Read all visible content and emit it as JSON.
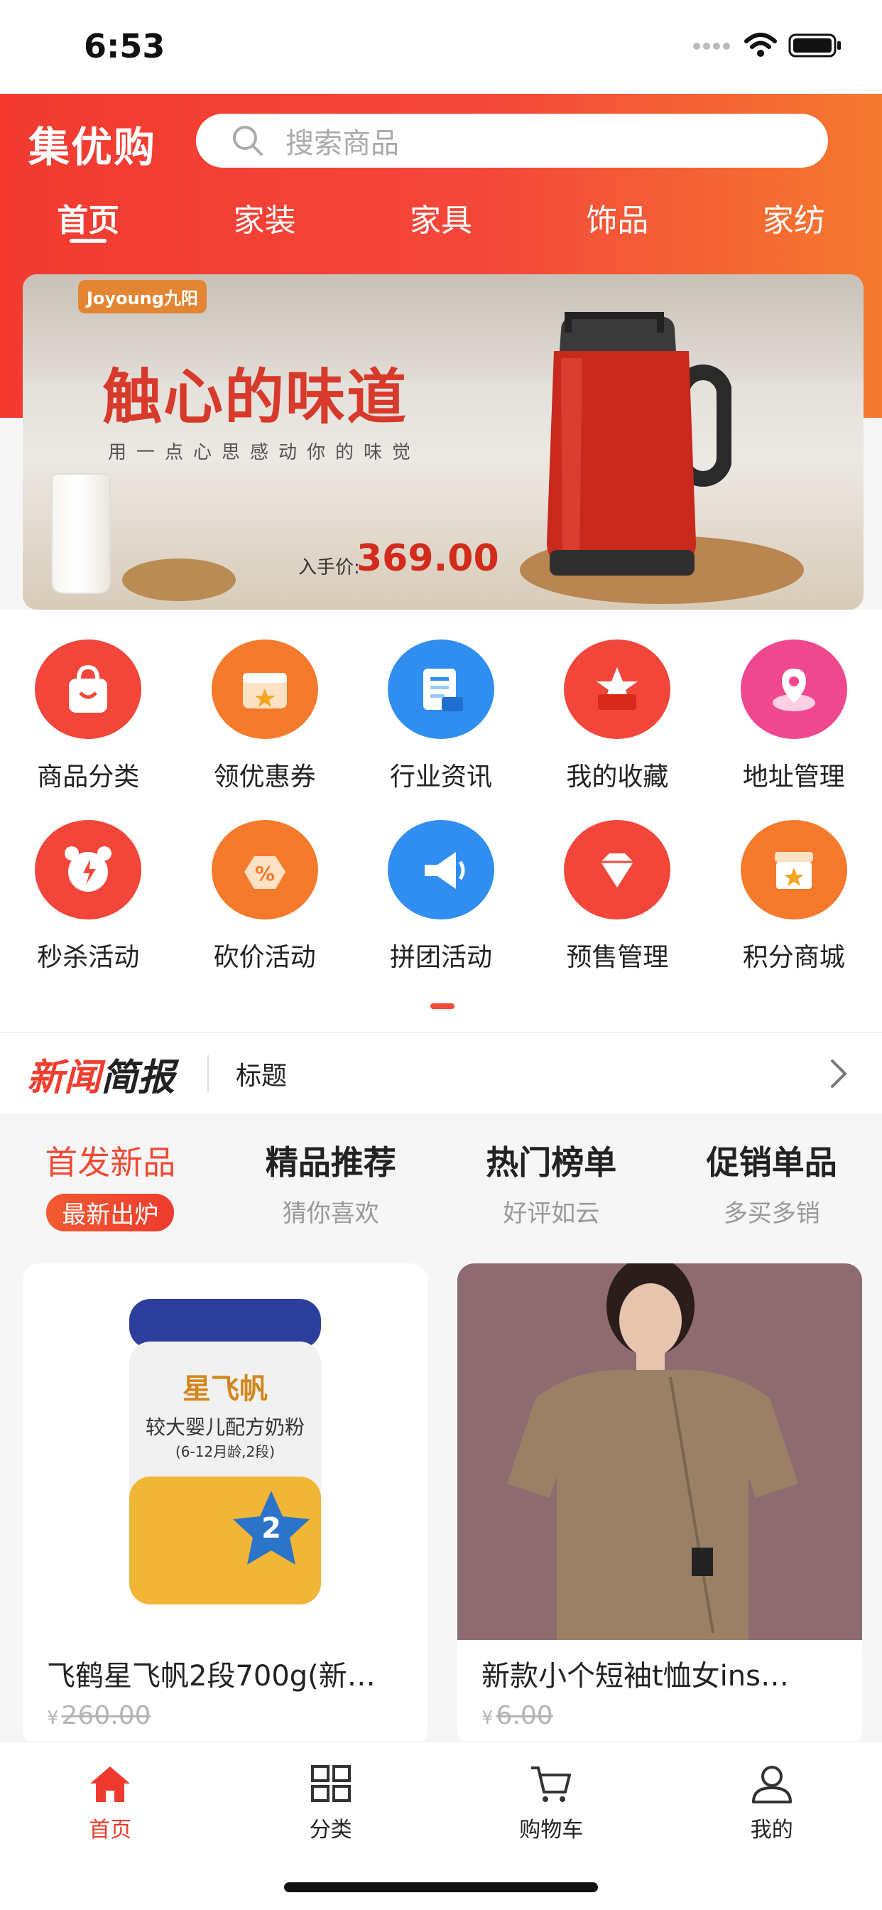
{
  "status_bar": {
    "time": "6:53"
  },
  "header": {
    "brand": "集优购",
    "search_placeholder": "搜索商品",
    "tabs": [
      {
        "label": "首页",
        "active": true
      },
      {
        "label": "家装",
        "active": false
      },
      {
        "label": "家具",
        "active": false
      },
      {
        "label": "饰品",
        "active": false
      },
      {
        "label": "家纺",
        "active": false
      }
    ]
  },
  "banner": {
    "logo_text": "Joyoung九阳",
    "title": "触心的味道",
    "subtitle": "用一点心思感动你的味觉",
    "price_label": "入手价:",
    "price": "369.00"
  },
  "quick_entries": {
    "row1": [
      {
        "label": "商品分类",
        "icon": "shopping-bag-icon",
        "color": "#f2463a"
      },
      {
        "label": "领优惠券",
        "icon": "coupon-icon",
        "color": "#f57a2c"
      },
      {
        "label": "行业资讯",
        "icon": "news-doc-icon",
        "color": "#2f8ef0"
      },
      {
        "label": "我的收藏",
        "icon": "star-box-icon",
        "color": "#f2463a"
      },
      {
        "label": "地址管理",
        "icon": "map-pin-icon",
        "color": "#f0488f"
      }
    ],
    "row2": [
      {
        "label": "秒杀活动",
        "icon": "alarm-clock-icon",
        "color": "#f2463a"
      },
      {
        "label": "砍价活动",
        "icon": "discount-tag-icon",
        "color": "#f57a2c"
      },
      {
        "label": "拼团活动",
        "icon": "megaphone-icon",
        "color": "#2f8ef0"
      },
      {
        "label": "预售管理",
        "icon": "diamond-icon",
        "color": "#f2463a"
      },
      {
        "label": "积分商城",
        "icon": "store-icon",
        "color": "#f57a2c"
      }
    ]
  },
  "news": {
    "logo_part1": "新闻",
    "logo_part2": "简报",
    "title": "标题"
  },
  "feature_tabs": [
    {
      "title": "首发新品",
      "sub": "最新出炉",
      "active": true
    },
    {
      "title": "精品推荐",
      "sub": "猜你喜欢",
      "active": false
    },
    {
      "title": "热门榜单",
      "sub": "好评如云",
      "active": false
    },
    {
      "title": "促销单品",
      "sub": "多买多销",
      "active": false
    }
  ],
  "products": [
    {
      "name": "飞鹤星飞帆2段700g(新…",
      "currency": "¥",
      "price": "260.00",
      "can_brand": "星飞帆",
      "can_text": "较大婴儿配方奶粉",
      "can_sub": "(6-12月龄,2段)",
      "can_stage": "2"
    },
    {
      "name": "新款小个短袖t恤女ins…",
      "currency": "¥",
      "price": "6.00"
    }
  ],
  "bottom_nav": [
    {
      "label": "首页",
      "icon": "home-icon",
      "active": true
    },
    {
      "label": "分类",
      "icon": "grid-icon",
      "active": false
    },
    {
      "label": "购物车",
      "icon": "cart-icon",
      "active": false
    },
    {
      "label": "我的",
      "icon": "user-icon",
      "active": false
    }
  ],
  "colors": {
    "brand_red": "#f23a2f",
    "brand_orange": "#f5792f",
    "accent_text": "#ef4a33"
  }
}
